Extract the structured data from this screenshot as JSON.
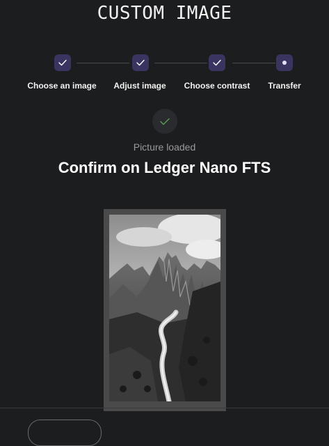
{
  "header": {
    "title": "CUSTOM IMAGE"
  },
  "stepper": {
    "steps": [
      {
        "label": "Choose an image",
        "state": "done"
      },
      {
        "label": "Adjust image",
        "state": "done"
      },
      {
        "label": "Choose contrast",
        "state": "done"
      },
      {
        "label": "Transfer",
        "state": "active"
      }
    ]
  },
  "status": {
    "icon": "check-icon",
    "text": "Picture loaded",
    "heading": "Confirm on Ledger Nano FTS"
  },
  "colors": {
    "background": "#1c1d1f",
    "step_bg": "#3a3460",
    "success": "#5a9a55"
  }
}
